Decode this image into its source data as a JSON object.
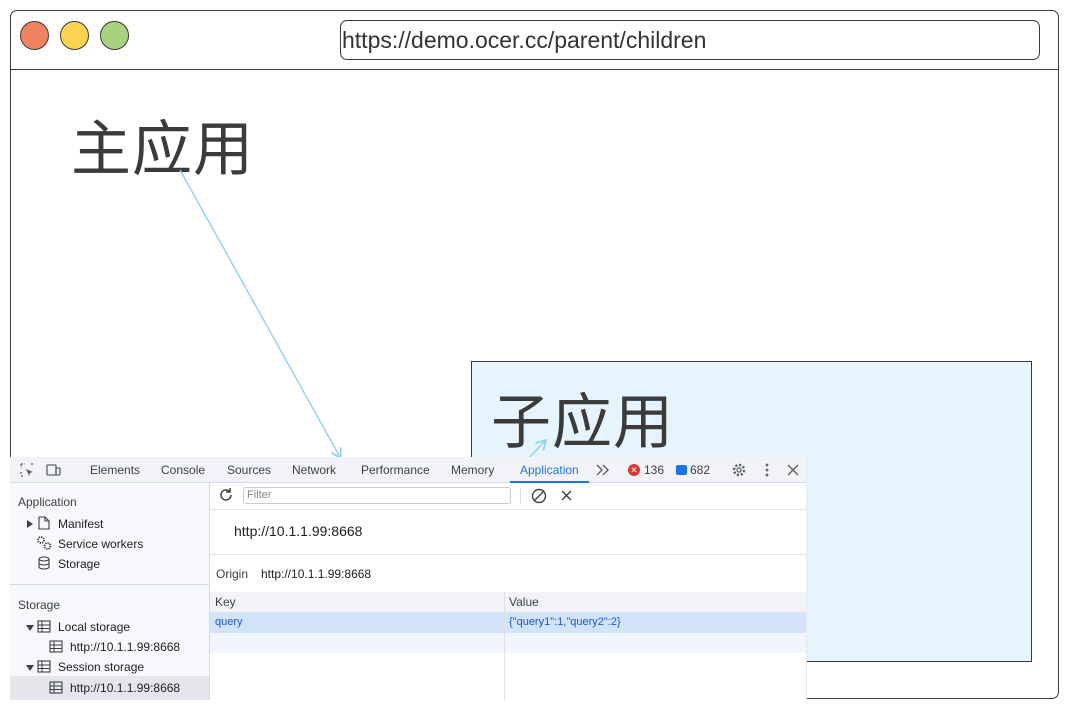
{
  "browser": {
    "window_controls": [
      "close",
      "minimize",
      "zoom"
    ],
    "url": "https://demo.ocer.cc/parent/children"
  },
  "main_app": {
    "title": "主应用"
  },
  "sub_app": {
    "title": "子应用"
  },
  "devtools": {
    "tabs": [
      "Elements",
      "Console",
      "Sources",
      "Network",
      "Performance",
      "Memory",
      "Application"
    ],
    "active_tab": "Application",
    "error_count": "136",
    "message_count": "682",
    "sidebar": {
      "application_section": "Application",
      "application_items": [
        "Manifest",
        "Service workers",
        "Storage"
      ],
      "storage_section": "Storage",
      "local_storage": {
        "label": "Local storage",
        "origin": "http://10.1.1.99:8668"
      },
      "session_storage": {
        "label": "Session storage",
        "origin": "http://10.1.1.99:8668"
      }
    },
    "content": {
      "filter_placeholder": "Filter",
      "origin_heading": "http://10.1.1.99:8668",
      "origin_label": "Origin",
      "origin_value": "http://10.1.1.99:8668",
      "columns": [
        "Key",
        "Value"
      ],
      "rows": [
        {
          "key": "query",
          "value": "{\"query1\":1,\"query2\":2}"
        }
      ]
    },
    "colors": {
      "accent": "#1a73e8",
      "error": "#dc362e",
      "selected_row": "#d2e3fc"
    }
  }
}
